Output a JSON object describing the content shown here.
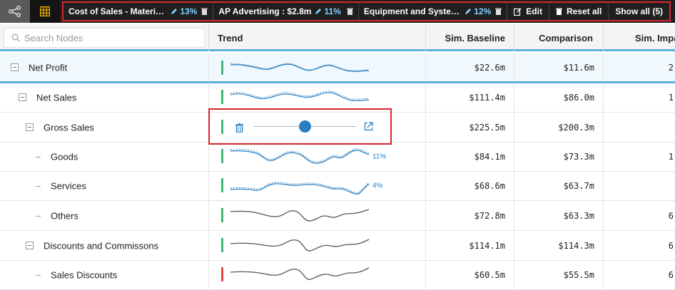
{
  "toolbar": {
    "chips": [
      {
        "name": "Cost of Sales - Material...",
        "pct": "13%"
      },
      {
        "name": "AP Advertising : $2.8m",
        "pct": "11%"
      },
      {
        "name": "Equipment and System...",
        "pct": "12%"
      }
    ],
    "edit_label": "Edit",
    "reset_label": "Reset all",
    "show_all_label": "Show all (5)"
  },
  "search": {
    "placeholder": "Search Nodes",
    "value": ""
  },
  "columns": {
    "trend": "Trend",
    "baseline": "Sim. Baseline",
    "comparison": "Comparison",
    "impact": "Sim. Impa"
  },
  "rows": [
    {
      "name": "Net Profit",
      "baseline": "$22.6m",
      "comparison": "$11.6m",
      "impact": "2",
      "bar": "#3cb873",
      "trend_label": ""
    },
    {
      "name": "Net Sales",
      "baseline": "$111.4m",
      "comparison": "$86.0m",
      "impact": "1",
      "bar": "#3cb873",
      "trend_label": ""
    },
    {
      "name": "Gross Sales",
      "baseline": "$225.5m",
      "comparison": "$200.3m",
      "impact": "",
      "bar": "#3cb873",
      "trend_label": ""
    },
    {
      "name": "Goods",
      "baseline": "$84.1m",
      "comparison": "$73.3m",
      "impact": "1",
      "bar": "#3cb873",
      "trend_label": "11%"
    },
    {
      "name": "Services",
      "baseline": "$68.6m",
      "comparison": "$63.7m",
      "impact": "",
      "bar": "#3cb873",
      "trend_label": "4%"
    },
    {
      "name": "Others",
      "baseline": "$72.8m",
      "comparison": "$63.3m",
      "impact": "6",
      "bar": "#3cb873",
      "trend_label": ""
    },
    {
      "name": "Discounts and Commissons",
      "baseline": "$114.1m",
      "comparison": "$114.3m",
      "impact": "6",
      "bar": "#3cb873",
      "trend_label": ""
    },
    {
      "name": "Sales Discounts",
      "baseline": "$60.5m",
      "comparison": "$55.5m",
      "impact": "6",
      "bar": "#e8453c",
      "trend_label": ""
    }
  ],
  "slider": {
    "value": 0.5
  },
  "colors": {
    "accent": "#2a7fc1",
    "positive": "#3cb873",
    "negative": "#e8453c",
    "highlight": "#d9262e"
  },
  "icons": [
    "share-nodes-icon",
    "grid-table-icon",
    "pencil-icon",
    "trash-icon",
    "edit-icon",
    "reset-icon",
    "search-icon",
    "collapse-icon",
    "open-external-icon"
  ]
}
